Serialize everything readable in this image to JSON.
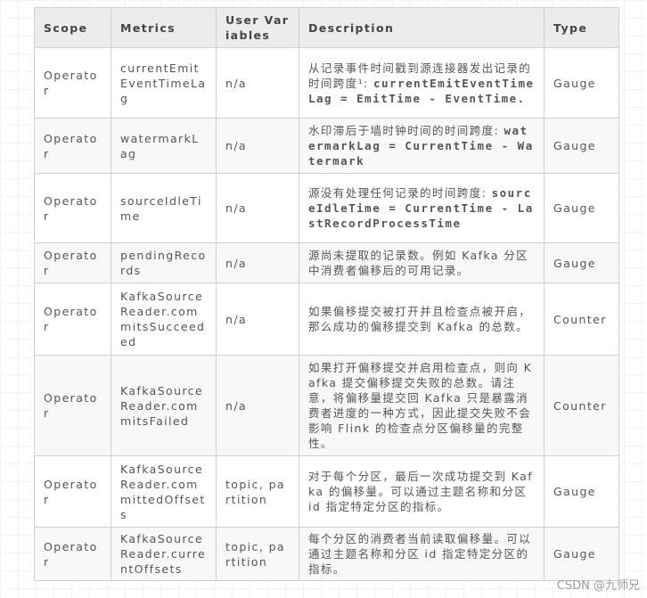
{
  "table": {
    "headers": [
      "Scope",
      "Metrics",
      "User Variables",
      "Description",
      "Type"
    ],
    "rows": [
      {
        "scope": "Operator",
        "metric": "currentEmitEventTimeLag",
        "vars": "n/a",
        "desc": "从记录事件时间戳到源连接器发出记录的时间跨度¹: ",
        "desc_code": "currentEmitEventTimeLag = EmitTime - EventTime.",
        "type": "Gauge"
      },
      {
        "scope": "Operator",
        "metric": "watermarkLag",
        "vars": "n/a",
        "desc": "水印滞后于墙时钟时间的时间跨度: ",
        "desc_code": "watermarkLag = CurrentTime - Watermark",
        "type": "Gauge"
      },
      {
        "scope": "Operator",
        "metric": "sourceIdleTime",
        "vars": "n/a",
        "desc": "源没有处理任何记录的时间跨度: ",
        "desc_code": "sourceIdleTime = CurrentTime - LastRecordProcessTime",
        "type": "Gauge"
      },
      {
        "scope": "Operator",
        "metric": "pendingRecords",
        "vars": "n/a",
        "desc": "源尚未提取的记录数。例如 Kafka 分区中消费者偏移后的可用记录。",
        "desc_code": "",
        "type": "Gauge"
      },
      {
        "scope": "Operator",
        "metric": "KafkaSourceReader.commitsSucceeded",
        "vars": "n/a",
        "desc": "如果偏移提交被打开并且检查点被开启，那么成功的偏移提交到 Kafka 的总数。",
        "desc_code": "",
        "type": "Counter"
      },
      {
        "scope": "Operator",
        "metric": "KafkaSourceReader.commitsFailed",
        "vars": "n/a",
        "desc": "如果打开偏移提交并启用检查点，则向 Kafka 提交偏移提交失败的总数。请注意，将偏移量提交回 Kafka 只是暴露消费者进度的一种方式，因此提交失败不会影响 Flink 的检查点分区偏移量的完整性。",
        "desc_code": "",
        "type": "Counter"
      },
      {
        "scope": "Operator",
        "metric": "KafkaSourceReader.committedOffsets",
        "vars": "topic, partition",
        "desc": "对于每个分区，最后一次成功提交到 Kafka 的偏移量。可以通过主题名称和分区 id 指定特定分区的指标。",
        "desc_code": "",
        "type": "Gauge"
      },
      {
        "scope": "Operator",
        "metric": "KafkaSourceReader.currentOffsets",
        "vars": "topic, partition",
        "desc": "每个分区的消费者当前读取偏移量。可以通过主题名称和分区 id 指定特定分区的指标。",
        "desc_code": "",
        "type": "Gauge"
      }
    ]
  },
  "watermark": "CSDN @九师兄"
}
